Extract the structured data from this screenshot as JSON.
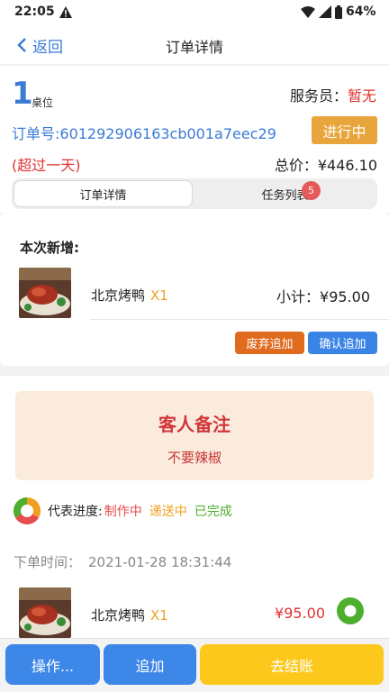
{
  "status_bar": {
    "time": "22:05",
    "battery": "64%",
    "icons": [
      "warning-icon",
      "wifi-icon",
      "signal-icon",
      "battery-icon"
    ]
  },
  "nav": {
    "back_label": "返回",
    "title": "订单详情"
  },
  "order": {
    "table_number": "1",
    "table_unit": "桌位",
    "waiter_label": "服务员：",
    "waiter_value": "暂无",
    "order_no": "订单号:601292906163cb001a7eec29",
    "status": "进行中",
    "overdue": "(超过一天)",
    "total_label": "总价：",
    "total_value": "¥446.10"
  },
  "tabs": [
    {
      "label": "订单详情",
      "active": true
    },
    {
      "label": "任务列表",
      "active": false,
      "badge": "5"
    }
  ],
  "new_items": {
    "title": "本次新增:",
    "items": [
      {
        "name": "北京烤鸭",
        "qty": "X1",
        "subtotal_label": "小计：",
        "subtotal_value": "¥95.00"
      }
    ],
    "discard_label": "废弃追加",
    "confirm_label": "确认追加"
  },
  "note": {
    "title": "客人备注",
    "text": "不要辣椒"
  },
  "legend": {
    "label": "代表进度:",
    "making": "制作中",
    "delivering": "递送中",
    "done": "已完成"
  },
  "order_time": {
    "label": "下单时间：",
    "value": "2021-01-28 18:31:44"
  },
  "ordered_items": [
    {
      "name": "北京烤鸭",
      "qty": "X1",
      "price": "¥95.00",
      "progress": "已完成"
    }
  ],
  "bottom_bar": {
    "operations": "操作...",
    "add": "追加",
    "checkout": "去结账"
  },
  "colors": {
    "primary": "#3a7bd5",
    "status_orange": "#e8a53c",
    "red": "#e0322f",
    "making": "#e64c4c",
    "delivering": "#f0a020",
    "done": "#4caf2d",
    "checkout": "#fdc81c"
  }
}
